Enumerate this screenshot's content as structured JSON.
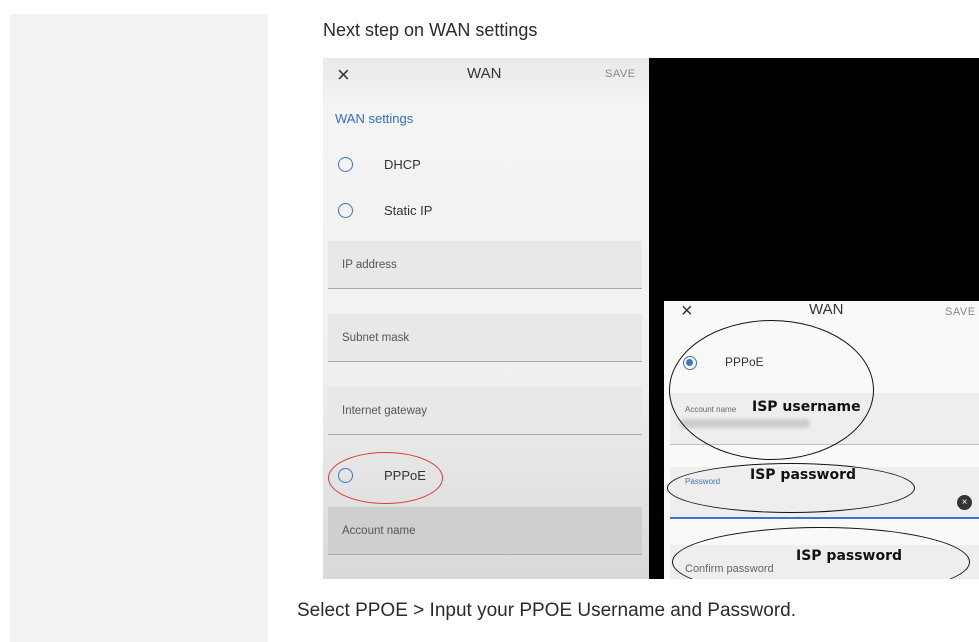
{
  "heading": "Next step on WAN settings",
  "caption": "Select PPOE > Input your PPOE Username and Password.",
  "phone1": {
    "close_glyph": "×",
    "title": "WAN",
    "save_label": "SAVE",
    "section_title": "WAN settings",
    "options": [
      {
        "label": "DHCP",
        "selected": false
      },
      {
        "label": "Static IP",
        "selected": false
      },
      {
        "label": "PPPoE",
        "selected": false
      }
    ],
    "fields": {
      "ip_address": "IP address",
      "subnet_mask": "Subnet mask",
      "internet_gateway": "Internet gateway",
      "account_name": "Account name"
    }
  },
  "phone2": {
    "close_glyph": "×",
    "title": "WAN",
    "save_label": "SAVE",
    "pppoe_label": "PPPoE",
    "account_name_label": "Account name",
    "password_label": "Password",
    "confirm_password_label": "Confirm password",
    "clear_glyph": "×"
  },
  "annotations": {
    "isp_username": "ISP username",
    "isp_password": "ISP password",
    "isp_password_confirm": "ISP password"
  },
  "colors": {
    "accent_blue": "#3d74c9",
    "highlight_red": "#e23b3b",
    "sidebar_bg": "#f1f3f2"
  }
}
